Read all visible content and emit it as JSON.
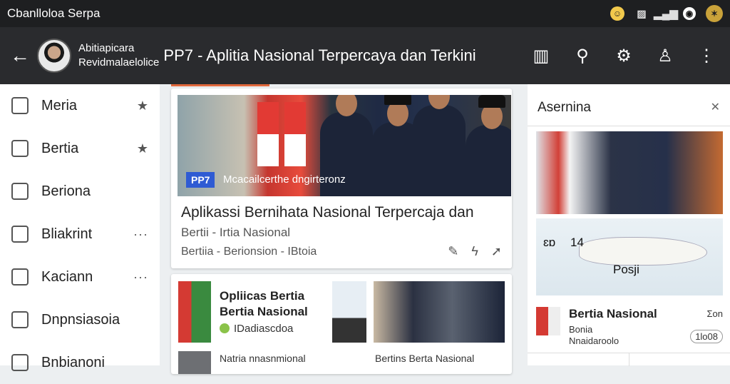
{
  "status_bar": {
    "title": "Cbanlloloa Serpa"
  },
  "app_bar": {
    "subtitle_line1": "Abitiapicara",
    "subtitle_line2": "Revidmalaelolice",
    "title": "PP7 - Aplitia Nasional Terpercaya dan Terkini"
  },
  "sidebar": {
    "items": [
      {
        "label": "Meria",
        "icon": "home-icon",
        "trail": "★"
      },
      {
        "label": "Bertia",
        "icon": "lock-icon",
        "trail": "★"
      },
      {
        "label": "Beriona",
        "icon": "grid-icon",
        "trail": ""
      },
      {
        "label": "Bliakrint",
        "icon": "house-icon",
        "trail": "···"
      },
      {
        "label": "Kaciann",
        "icon": "doc-icon",
        "trail": "···"
      },
      {
        "label": "Dnpnsiasoia",
        "icon": "page-icon",
        "trail": ""
      },
      {
        "label": "Bnbianoni",
        "icon": "user-icon",
        "trail": ""
      }
    ]
  },
  "main": {
    "card1": {
      "badge": "PP7",
      "caption": "Mcacailcerthe dngirteronz",
      "title": "Aplikassi Bernihata Nasional Terpercaja dan",
      "subtitle": "Bertii - Irtia Nasional",
      "meta": "Bertiia - Berionsion - IBtoia"
    },
    "card2": {
      "title": "Opliicas Bertia Bertia Nasional",
      "tag": "IDadiascdoa",
      "sub_left": "Natria nnasnmional",
      "sub_right": "Bertins Berta Nasional"
    }
  },
  "right_panel": {
    "heading": "Asernina",
    "map_labels": [
      "ɛɒ",
      "14",
      "Posji"
    ],
    "item": {
      "title": "Bertia Nasional",
      "sub1": "Bonia",
      "sub2": "Nnaidaroolo",
      "count": "Ʃon",
      "chip": "1lo08"
    }
  }
}
